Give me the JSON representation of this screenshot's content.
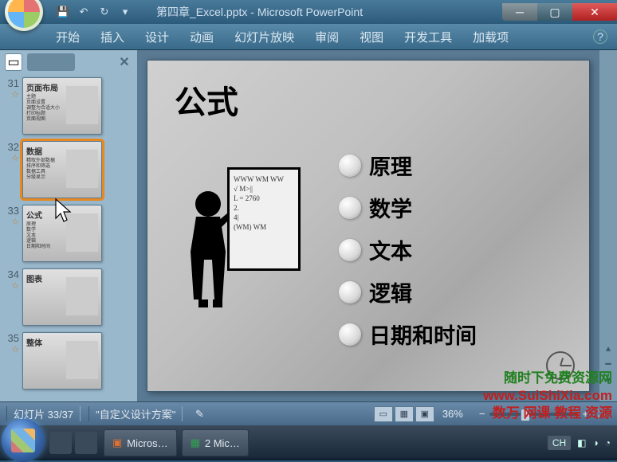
{
  "title": "第四章_Excel.pptx - Microsoft PowerPoint",
  "ribbon": {
    "tabs": [
      "开始",
      "插入",
      "设计",
      "动画",
      "幻灯片放映",
      "审阅",
      "视图",
      "开发工具",
      "加载项"
    ]
  },
  "thumbnails": [
    {
      "num": "31",
      "title": "页面布局",
      "lines": "主题 页面设置 调整为合适大小 打印标题 页面视图"
    },
    {
      "num": "32",
      "title": "数据",
      "lines": "精取外部数据 排序和筛选 数据工具 分级显示",
      "selected": true
    },
    {
      "num": "33",
      "title": "公式",
      "lines": "原理 数学 文本 逻辑 日期和时间"
    },
    {
      "num": "34",
      "title": "图表",
      "lines": ""
    },
    {
      "num": "35",
      "title": "整体",
      "lines": ""
    }
  ],
  "slide": {
    "title": "公式",
    "board_lines": [
      "WWW WM WW",
      "√ M>||",
      "L = 2760",
      "2.",
      "4|",
      "(WM) WM"
    ],
    "bullets": [
      "原理",
      "数学",
      "文本",
      "逻辑",
      "日期和时间"
    ]
  },
  "status": {
    "slide_count": "幻灯片 33/37",
    "layout": "\"自定义设计方案\"",
    "zoom": "36%"
  },
  "taskbar": {
    "items": [
      "Micros…",
      "2 Mic…"
    ],
    "lang": "CH"
  },
  "watermark": {
    "line1": "随时下免费资源网",
    "line2": "www.SuiShiXia.com",
    "line3": "数万 网课 教程 资源"
  }
}
